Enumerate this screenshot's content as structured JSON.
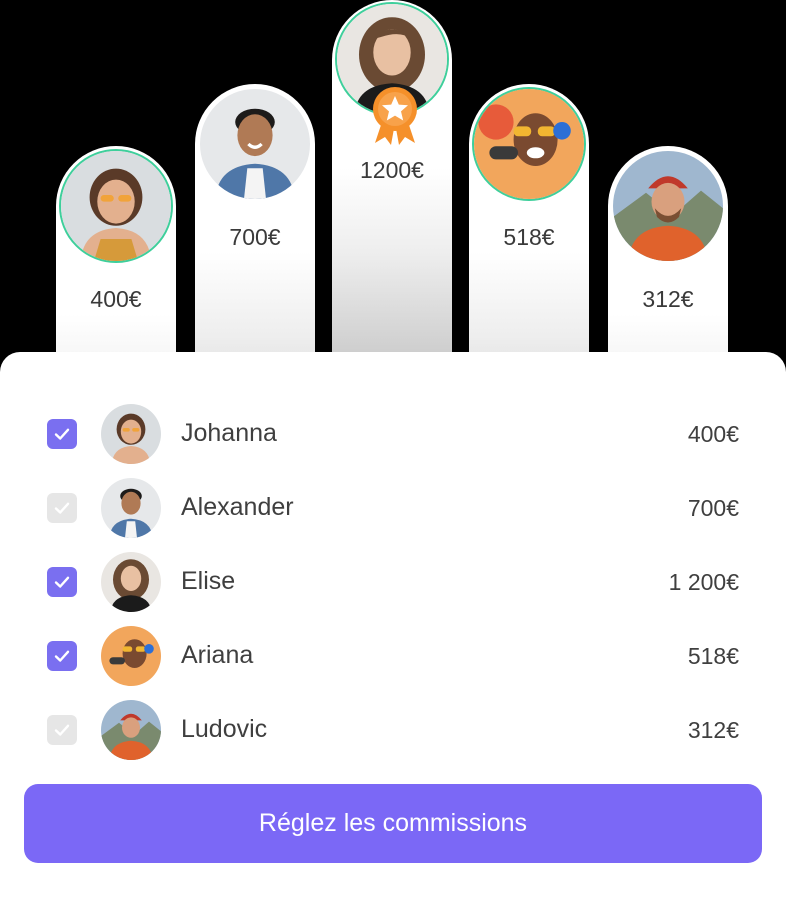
{
  "podium": [
    {
      "name": "Johanna",
      "amount": "400€",
      "ring": "green"
    },
    {
      "name": "Alexander",
      "amount": "700€",
      "ring": "white"
    },
    {
      "name": "Elise",
      "amount": "1200€",
      "ring": "green",
      "badge": "star-award-icon"
    },
    {
      "name": "Ariana",
      "amount": "518€",
      "ring": "green"
    },
    {
      "name": "Ludovic",
      "amount": "312€",
      "ring": "white"
    }
  ],
  "list": [
    {
      "name": "Johanna",
      "amount": "400€",
      "checked": true
    },
    {
      "name": "Alexander",
      "amount": "700€",
      "checked": false
    },
    {
      "name": "Elise",
      "amount": "1 200€",
      "checked": true
    },
    {
      "name": "Ariana",
      "amount": "518€",
      "checked": true
    },
    {
      "name": "Ludovic",
      "amount": "312€",
      "checked": false
    }
  ],
  "button": {
    "label": "Réglez les commissions"
  },
  "colors": {
    "accent": "#7b68f6",
    "checkbox_on": "#7a6ff0",
    "checkbox_off": "#e6e6e6",
    "ring": "#3ecf9b",
    "badge": "#f5902a"
  }
}
